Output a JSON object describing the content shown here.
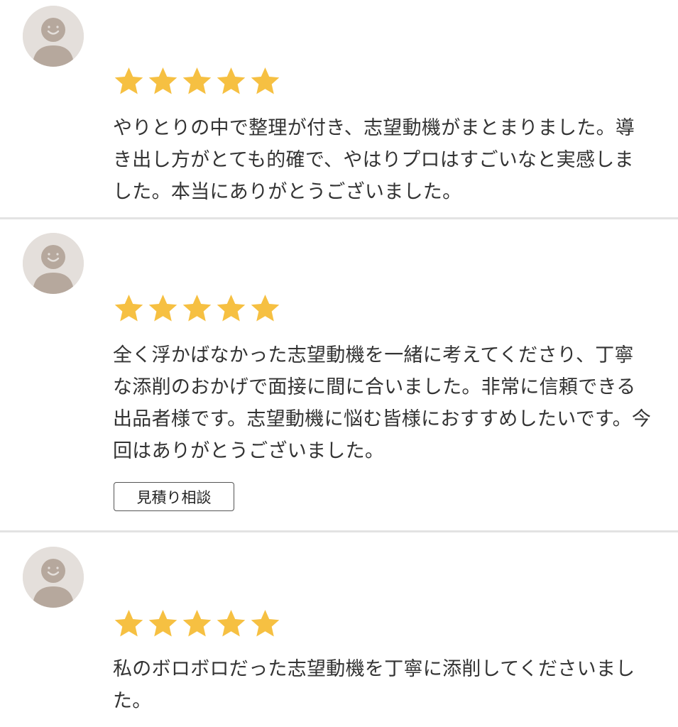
{
  "reviews": [
    {
      "avatar_icon": "user-avatar-icon",
      "rating": 5,
      "comment": "やりとりの中で整理が付き、志望動機がまとまりました。導き出し方がとても的確で、やはりプロはすごいなと実感しました。本当にありがとうございました。"
    },
    {
      "avatar_icon": "user-avatar-icon",
      "rating": 5,
      "comment": "全く浮かばなかった志望動機を一緒に考えてくださり、丁寧な添削のおかげで面接に間に合いました。非常に信頼できる出品者様です。志望動機に悩む皆様におすすめしたいです。今回はありがとうございました。",
      "button_label": "見積り相談"
    },
    {
      "avatar_icon": "user-avatar-icon",
      "rating": 5,
      "comment": "私のボロボロだった志望動機を丁寧に添削してくださいました。"
    }
  ],
  "colors": {
    "star": "#f6c042",
    "avatar_bg": "#e4dfdb",
    "avatar_figure": "#b6a89d",
    "divider": "#e3e3e3",
    "text": "#333333"
  }
}
